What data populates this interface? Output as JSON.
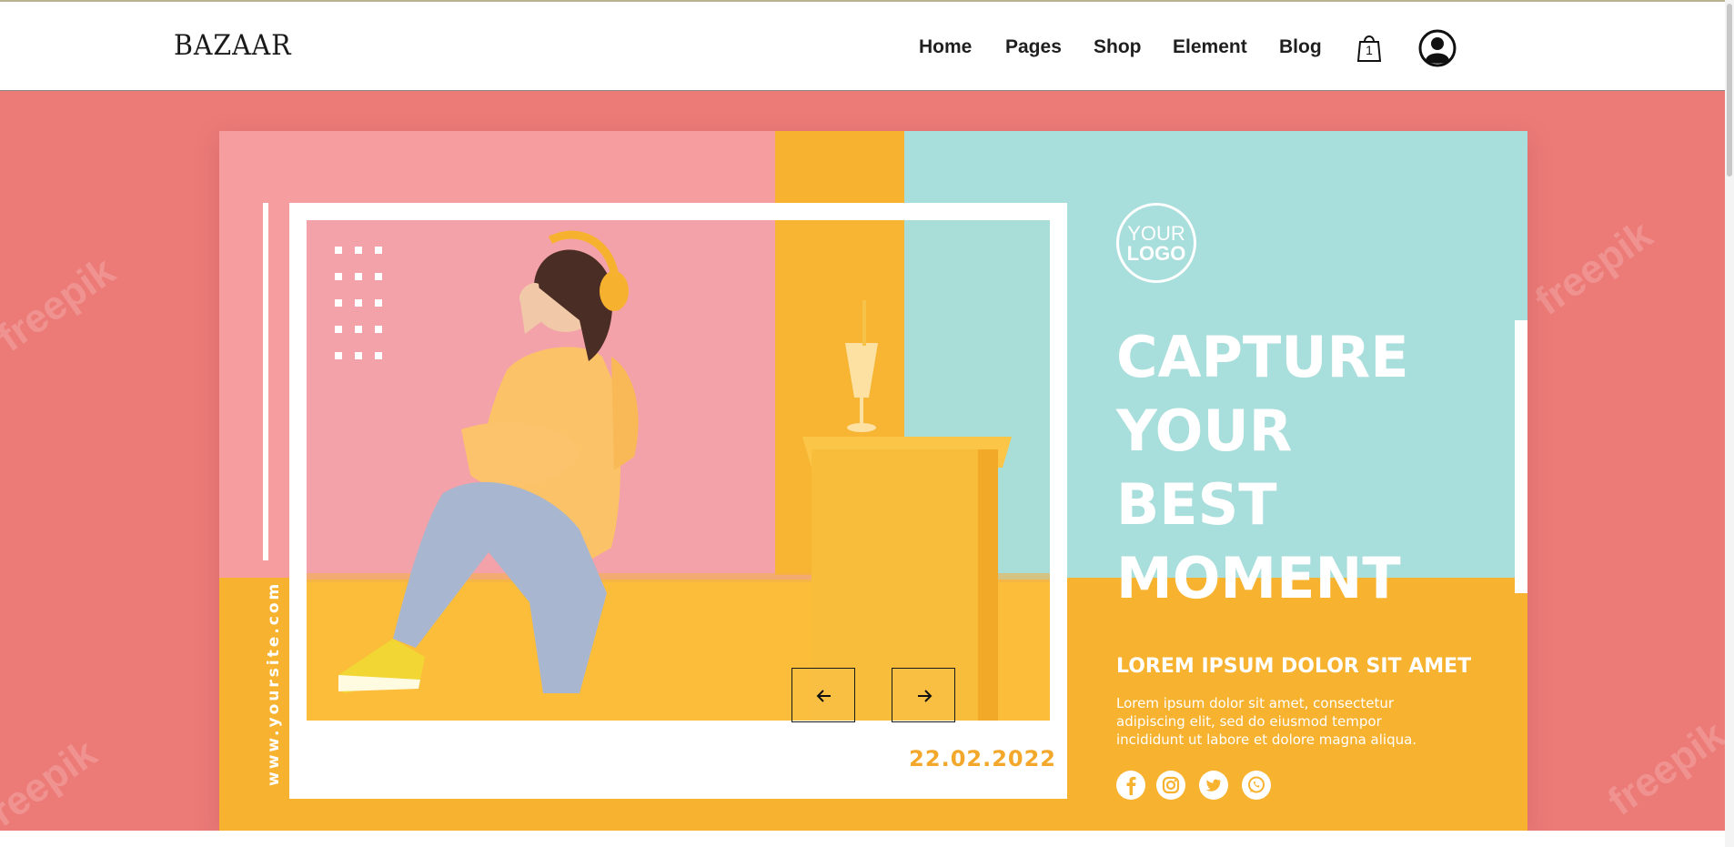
{
  "header": {
    "logo": "BAZAAR",
    "nav": [
      {
        "label": "Home"
      },
      {
        "label": "Pages"
      },
      {
        "label": "Shop"
      },
      {
        "label": "Element"
      },
      {
        "label": "Blog"
      }
    ],
    "cart_count": "1"
  },
  "hero": {
    "watermark": "freepik",
    "banner": {
      "logo_line1": "YOUR",
      "logo_line2": "LOGO",
      "headline": [
        "CAPTURE",
        "YOUR",
        "BEST",
        "MOMENT"
      ],
      "subheading": "LOREM IPSUM DOLOR SIT AMET",
      "body_lines": [
        "Lorem ipsum dolor sit amet, consectetur",
        "adipiscing elit, sed do eiusmod tempor",
        "incididunt ut labore et dolore magna aliqua."
      ],
      "date": "22.02.2022",
      "website": "www.yoursite.com",
      "socials": [
        "facebook-icon",
        "instagram-icon",
        "twitter-icon",
        "whatsapp-icon"
      ]
    },
    "controls": {
      "prev": "arrow-left-icon",
      "next": "arrow-right-icon"
    }
  },
  "colors": {
    "hero_background": "#ec7b78",
    "banner_pink": "#f69da0",
    "banner_orange": "#f7b22f",
    "banner_teal": "#a8dedb"
  }
}
